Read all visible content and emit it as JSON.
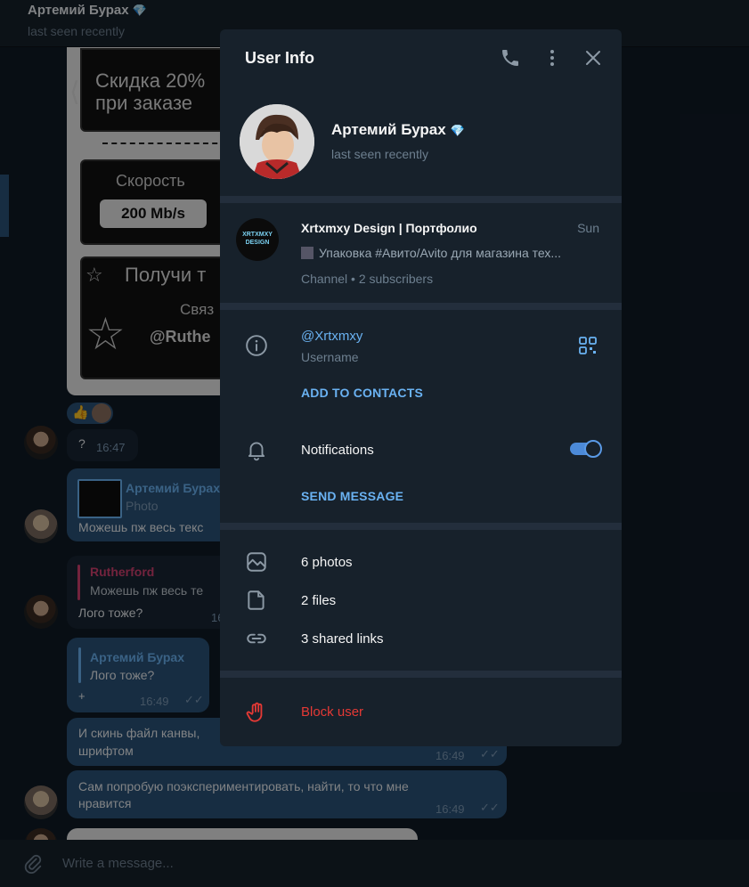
{
  "chat_header": {
    "name": "Артемий Бурах",
    "status": "last seen recently"
  },
  "image_message": {
    "promo_line1": "Скидка 20%",
    "promo_line2": "при заказе",
    "speed_label": "Скорость",
    "speed_value": "200 Mb/s",
    "cta": "Получи т",
    "contact": "Связ",
    "handle": "@Ruthe"
  },
  "messages": [
    {
      "text": "?",
      "time": "16:47"
    },
    {
      "quote_author": "Артемий Бурах",
      "quote_text": "Photo",
      "text": "Можешь пж весь текс"
    },
    {
      "quote_author": "Rutherford",
      "quote_text": "Можешь пж весь те",
      "text": "Лого тоже?",
      "time": "16"
    },
    {
      "quote_author": "Артемий Бурах",
      "quote_text": "Лого тоже?",
      "text": "+",
      "time": "16:49"
    },
    {
      "text_line1": "И скинь файл канвы,",
      "text_line2": "шрифтом",
      "time": "16:49"
    },
    {
      "text_line1": "Сам попробую поэкспериментировать, найти, то что мне",
      "text_line2": "нравится",
      "time": "16:49"
    }
  ],
  "composer": {
    "placeholder": "Write a message..."
  },
  "panel": {
    "title": "User Info",
    "profile": {
      "name": "Артемий Бурах",
      "status": "last seen recently"
    },
    "channel": {
      "title": "Xrtxmxy Design | Портфолио",
      "date": "Sun",
      "preview": "Упаковка #Авито/Avito для магазина тех...",
      "meta": "Channel • 2 subscribers",
      "avatar_text": "XRTXMXY DESIGN"
    },
    "username": {
      "value": "@Xrtxmxy",
      "label": "Username"
    },
    "add_to_contacts": "ADD TO CONTACTS",
    "notifications": {
      "label": "Notifications",
      "enabled": true
    },
    "send_message": "SEND MESSAGE",
    "media": {
      "photos": "6 photos",
      "files": "2 files",
      "links": "3 shared links"
    },
    "block_user": "Block user"
  },
  "colors": {
    "accent": "#6ab2f2",
    "danger": "#e53935",
    "panel_bg": "#17212b",
    "toggle": "#4c8ad8"
  }
}
